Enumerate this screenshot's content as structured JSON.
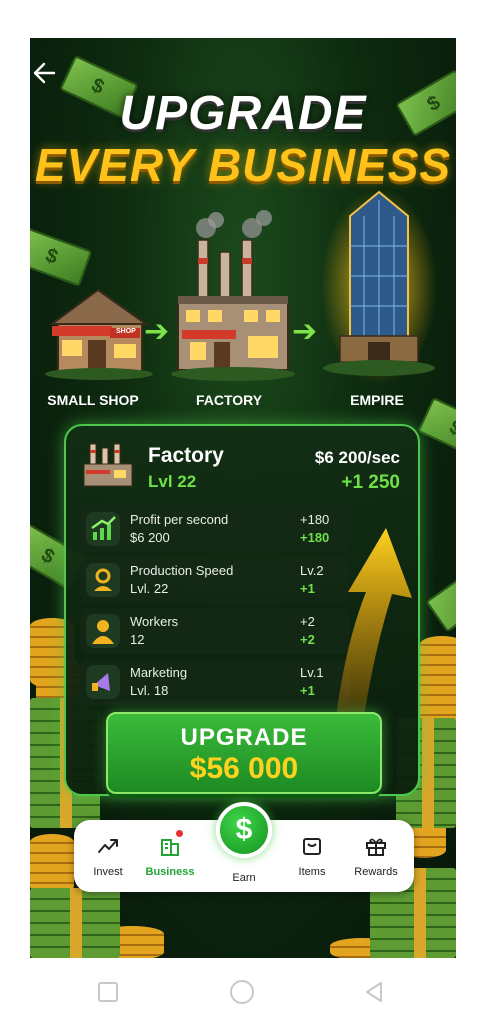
{
  "hero": {
    "title_line1": "UPGRADE",
    "title_line2": "EVERY BUSINESS"
  },
  "buildings": [
    {
      "label": "SMALL SHOP",
      "sign": "SHOP"
    },
    {
      "label": "FACTORY"
    },
    {
      "label": "EMPIRE"
    }
  ],
  "card": {
    "name": "Factory",
    "level": "Lvl 22",
    "rate": "$6 200/sec",
    "gain": "+1 250",
    "stats": [
      {
        "name": "Profit per second",
        "value": "$6 200",
        "right_top": "+180",
        "right_bottom": "+180",
        "icon": "chart-up-icon"
      },
      {
        "name": "Production Speed",
        "value": "Lvl. 22",
        "right_top": "Lv.2",
        "right_bottom": "+1",
        "icon": "gear-person-icon"
      },
      {
        "name": "Workers",
        "value": "12",
        "right_top": "+2",
        "right_bottom": "+2",
        "icon": "worker-icon"
      },
      {
        "name": "Marketing",
        "value": "Lvl. 18",
        "right_top": "Lv.1",
        "right_bottom": "+1",
        "icon": "megaphone-icon"
      }
    ]
  },
  "upgrade_button": {
    "label": "UPGRADE",
    "price": "$56 000"
  },
  "tabs": [
    {
      "label": "Invest",
      "icon": "trend-icon",
      "active": false
    },
    {
      "label": "Business",
      "icon": "building-icon",
      "active": true
    },
    {
      "label": "Earn",
      "icon": "dollar-icon",
      "active": false
    },
    {
      "label": "Items",
      "icon": "bag-icon",
      "active": false
    },
    {
      "label": "Rewards",
      "icon": "gift-icon",
      "active": false
    }
  ],
  "colors": {
    "accent_green": "#6ee04a",
    "gold": "#ffc21a",
    "background": "#0d2a0f"
  }
}
